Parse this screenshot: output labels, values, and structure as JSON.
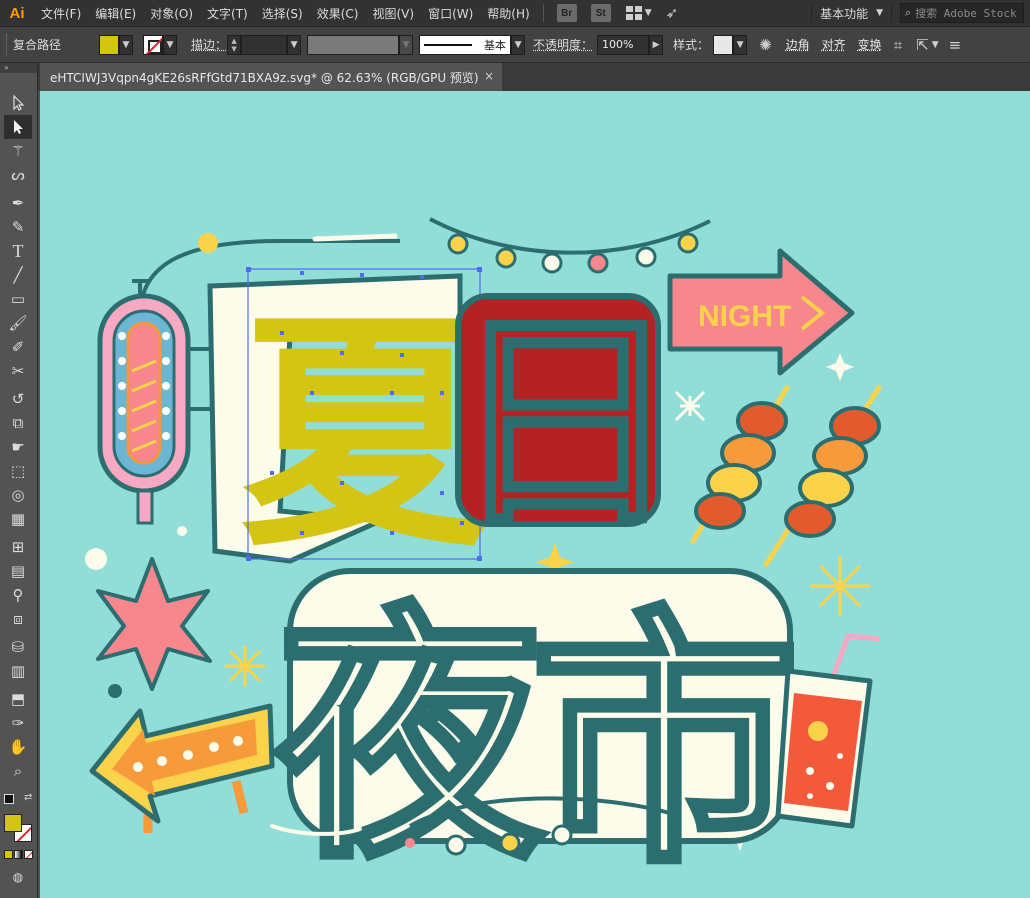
{
  "menubar": {
    "logo": "Ai",
    "items": [
      "文件(F)",
      "编辑(E)",
      "对象(O)",
      "文字(T)",
      "选择(S)",
      "效果(C)",
      "视图(V)",
      "窗口(W)",
      "帮助(H)"
    ],
    "bridge": "Br",
    "stock": "St",
    "workspace": "基本功能",
    "search_placeholder": "搜索 Adobe Stock"
  },
  "controlbar": {
    "selection_type": "复合路径",
    "fill_color": "#d4c413",
    "stroke_label": "描边：",
    "brush_label": "基本",
    "opacity_label": "不透明度：",
    "opacity_value": "100%",
    "style_label": "样式：",
    "corner_label": "边角",
    "align_label": "对齐",
    "transform_label": "变换"
  },
  "document": {
    "tab_title": "eHTCIWJ3Vqpn4gKE26sRFfGtd71BXA9z.svg* @ 62.63% (RGB/GPU 预览)",
    "close": "×"
  },
  "tools": {
    "collapse": "»",
    "fill_color": "#d4c413"
  },
  "artwork": {
    "char_xia": "夏",
    "char_ri": "日",
    "char_ye": "夜",
    "char_shi": "市",
    "sign_text": "NIGHT",
    "colors": {
      "background": "#91ddd8",
      "outline": "#2c6e70",
      "cream": "#fdfbe9",
      "yellow": "#d4c413",
      "red": "#b52224",
      "pink": "#f7868d",
      "orange": "#f79a3b",
      "selection": "#4f6cf0"
    }
  }
}
